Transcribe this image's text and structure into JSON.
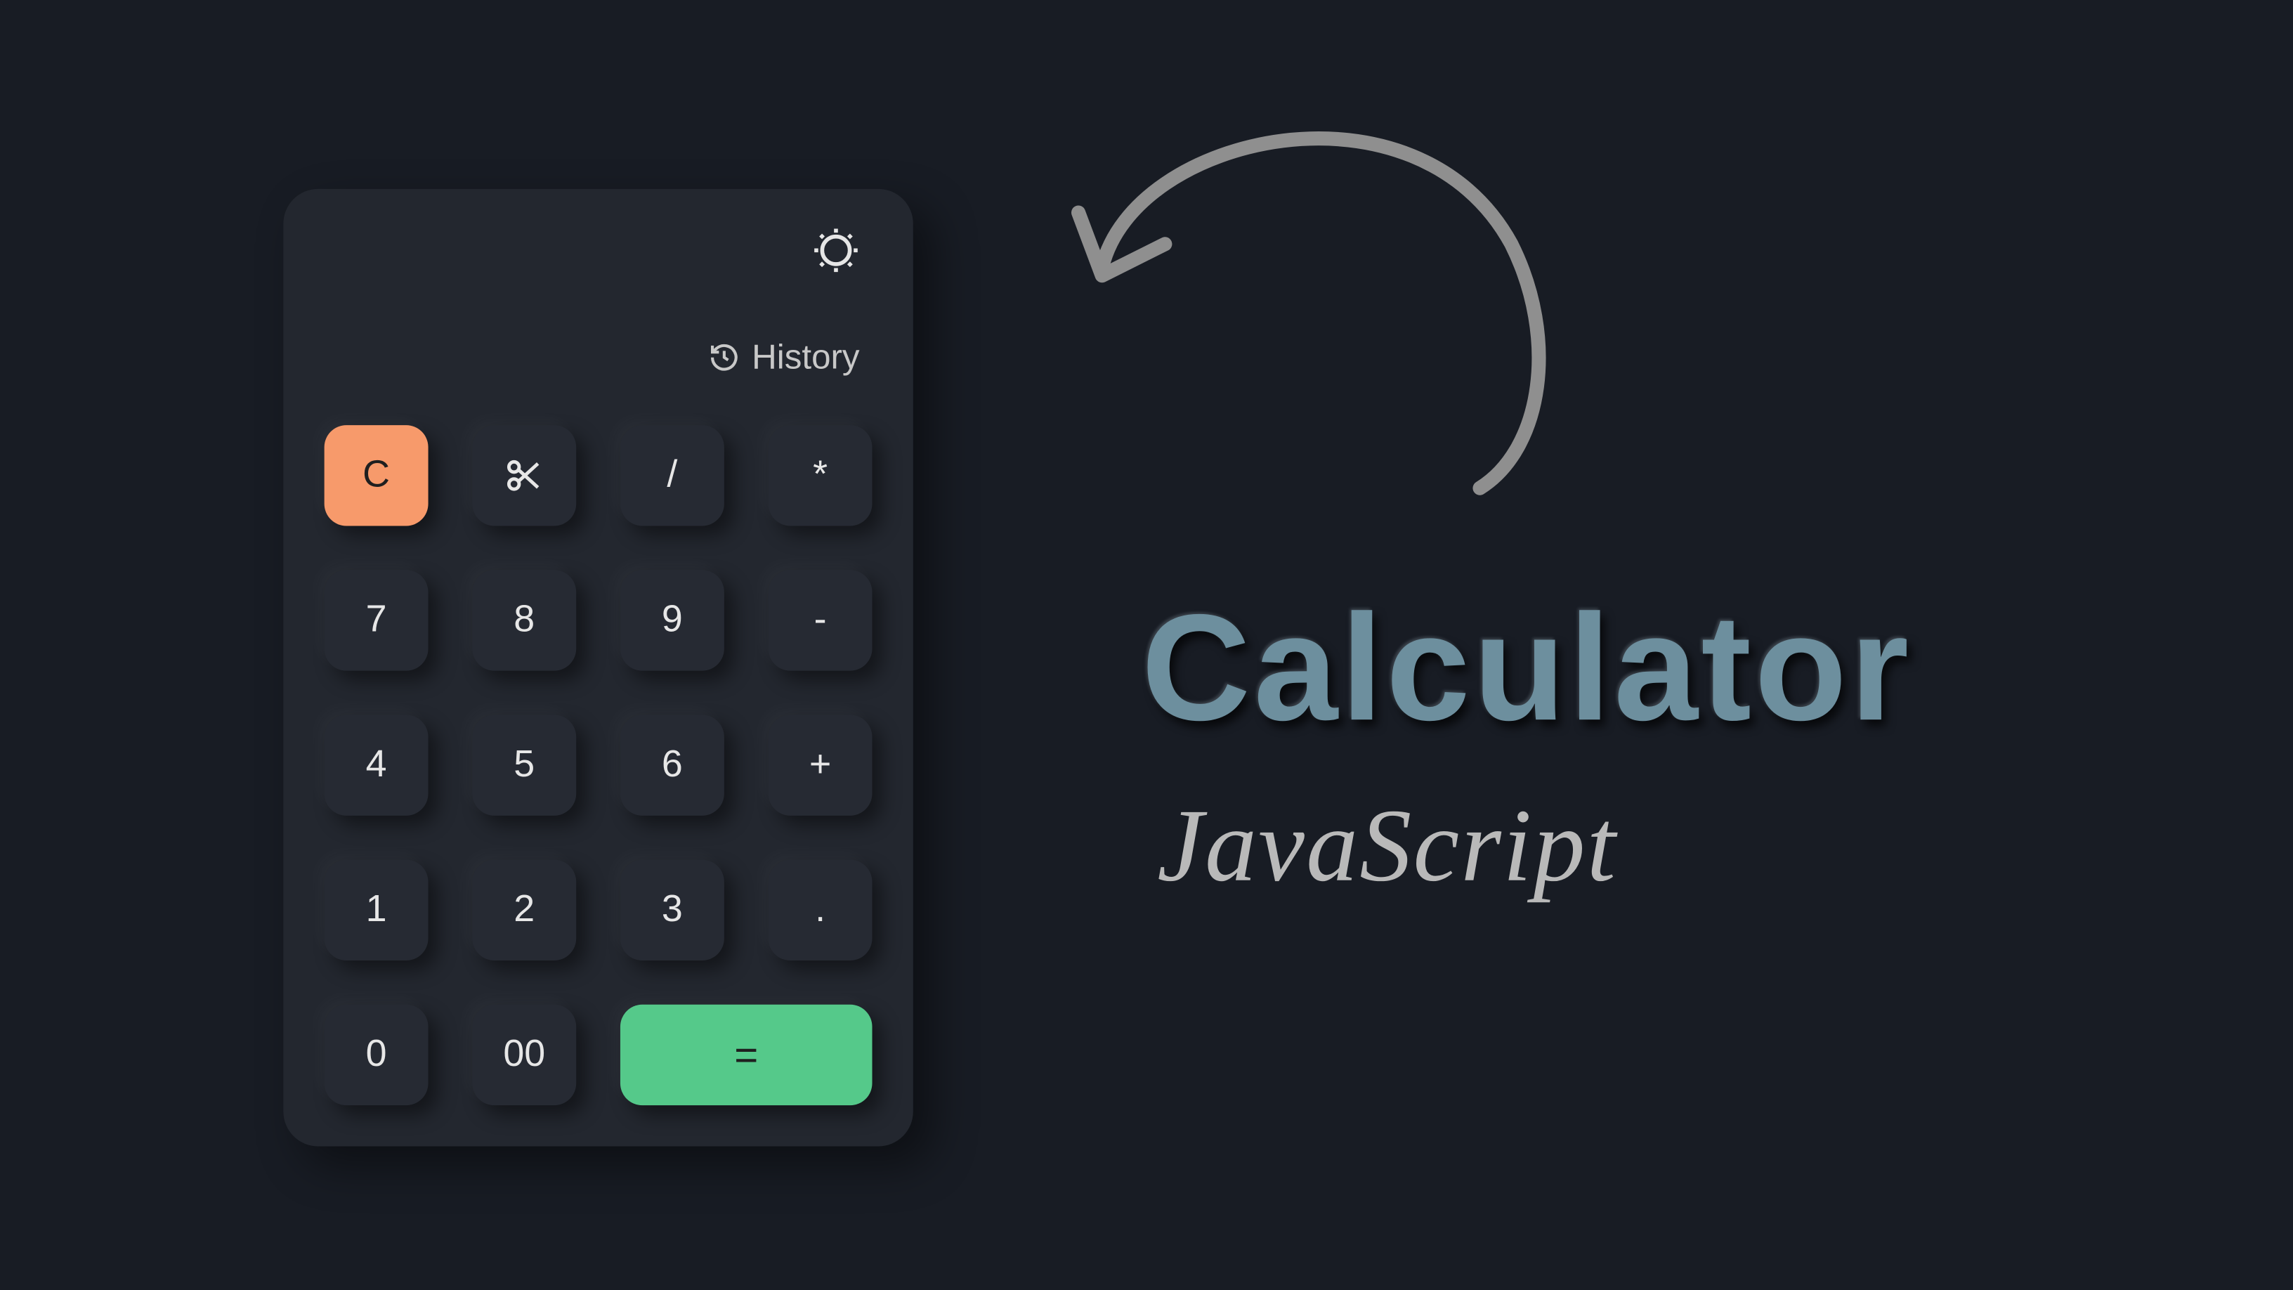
{
  "history_label": "History",
  "keys": {
    "clear": "C",
    "divide": "/",
    "multiply": "*",
    "seven": "7",
    "eight": "8",
    "nine": "9",
    "minus": "-",
    "four": "4",
    "five": "5",
    "six": "6",
    "plus": "+",
    "one": "1",
    "two": "2",
    "three": "3",
    "dot": ".",
    "zero": "0",
    "dzero": "00",
    "equals": "="
  },
  "title": "Calculator",
  "subtitle": "JavaScript",
  "colors": {
    "bg": "#181c24",
    "panel": "#23272f",
    "key": "#262a33",
    "clear": "#f79a6b",
    "equals": "#55c98a",
    "title": "#6d8f9e",
    "subtitle": "#b9b9b9"
  }
}
